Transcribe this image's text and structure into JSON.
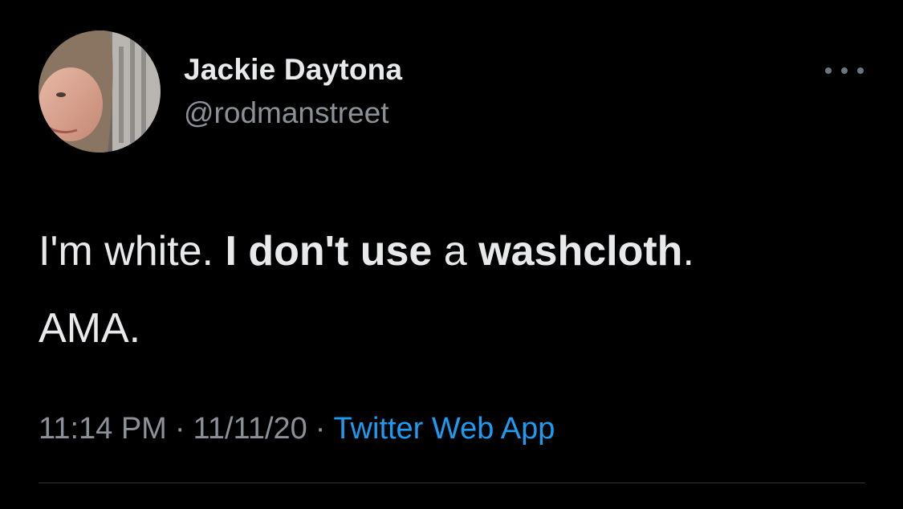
{
  "user": {
    "display_name": "Jackie Daytona",
    "handle": "@rodmanstreet",
    "avatar_icon": "profile-photo"
  },
  "more_icon": "more-horizontal-icon",
  "tweet": {
    "line1": [
      {
        "text": "I'm white. ",
        "bold": false
      },
      {
        "text": "I don't use",
        "bold": true
      },
      {
        "text": " a ",
        "bold": false
      },
      {
        "text": "washcloth",
        "bold": true
      },
      {
        "text": ".",
        "bold": false
      }
    ],
    "line2": "AMA."
  },
  "meta": {
    "time": "11:14 PM",
    "separator": "·",
    "date": "11/11/20",
    "source": "Twitter Web App"
  },
  "colors": {
    "background": "#000000",
    "text": "#e7e9ea",
    "secondary": "#8b9197",
    "link": "#1d9bf0",
    "divider": "#2f3336"
  }
}
